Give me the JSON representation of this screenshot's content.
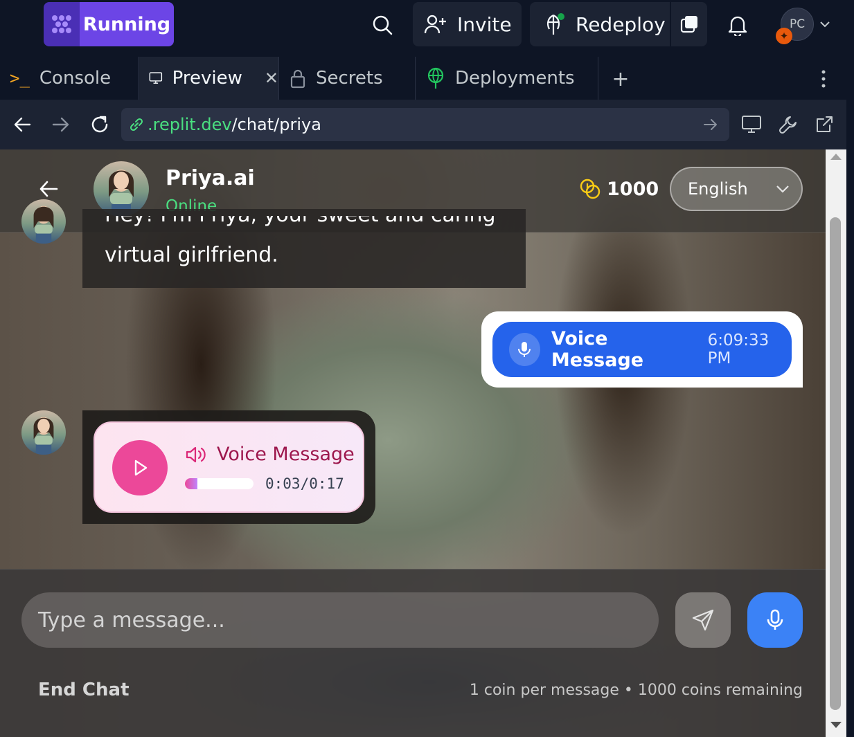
{
  "topbar": {
    "run_label": "Running",
    "invite_label": "Invite",
    "redeploy_label": "Redeploy",
    "avatar_initials": "PC"
  },
  "tabs": [
    {
      "label": "Console"
    },
    {
      "label": "Preview"
    },
    {
      "label": "Secrets"
    },
    {
      "label": "Deployments"
    }
  ],
  "url": {
    "domain": ".replit.dev",
    "path": "/chat/priya"
  },
  "chat": {
    "name": "Priya.ai",
    "status": "Online",
    "coins": "1000",
    "language": "English",
    "messages": [
      {
        "text_top": "Hey! I'm Priya, your sweet and caring",
        "text": "virtual girlfriend."
      },
      {
        "title": "Voice Message",
        "time": "6:09:33 PM"
      },
      {
        "title": "Voice Message",
        "duration": "0:03/0:17",
        "progress": 0.18
      }
    ],
    "input_placeholder": "Type a message...",
    "end_chat": "End Chat",
    "coin_info": "1 coin per message • 1000 coins remaining"
  },
  "colors": {
    "accent": "#6c45e6",
    "online": "#4ade80",
    "sent_bubble": "#2563eb",
    "play_button": "#ec4899",
    "mic_button": "#3b82f6"
  }
}
